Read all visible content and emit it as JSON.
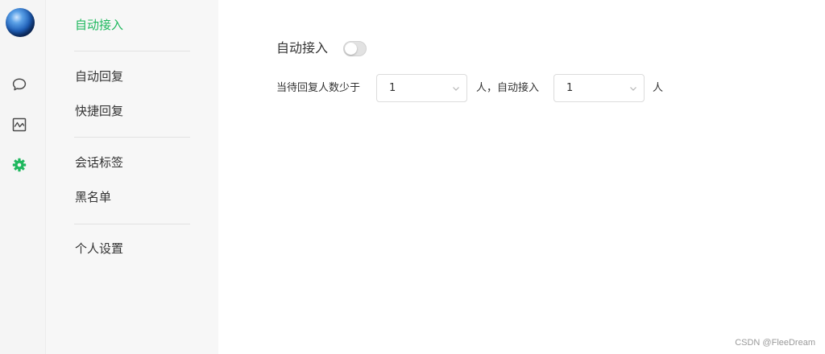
{
  "rail": {
    "avatar_icon": "globe-avatar",
    "icons": [
      "chat-bubble-icon",
      "chart-icon",
      "gear-icon"
    ],
    "active_icon": "gear-icon",
    "accent_color": "#1fb85e"
  },
  "menu": {
    "groups": [
      [
        {
          "label": "自动接入",
          "active": true
        }
      ],
      [
        {
          "label": "自动回复"
        },
        {
          "label": "快捷回复"
        }
      ],
      [
        {
          "label": "会话标签"
        },
        {
          "label": "黑名单"
        }
      ],
      [
        {
          "label": "个人设置"
        }
      ]
    ]
  },
  "settings": {
    "auto_accept_label": "自动接入",
    "auto_accept_enabled": false,
    "condition_prefix": "当待回复人数少于",
    "threshold_value": "1",
    "condition_middle": "人，自动接入",
    "accept_count_value": "1",
    "condition_suffix": "人"
  },
  "watermark": "CSDN @FleeDream"
}
